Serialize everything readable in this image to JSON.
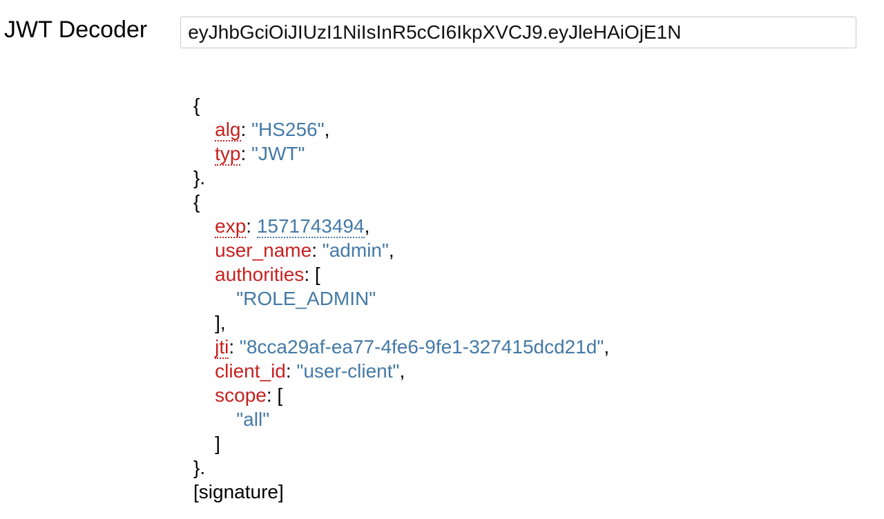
{
  "page": {
    "title": "JWT Decoder",
    "token_value": "eyJhbGciOiJIUzI1NiIsInR5cCI6IkpXVCJ9.eyJleHAiOjE1N"
  },
  "decoded": {
    "open_brace": "{",
    "close_brace": "}",
    "dot": ".",
    "open_bracket": "[",
    "close_bracket": "]",
    "colon_space": ": ",
    "comma": ",",
    "signature_label": "[signature]",
    "header": {
      "alg": {
        "key": "alg",
        "value": "\"HS256\""
      },
      "typ": {
        "key": "typ",
        "value": "\"JWT\""
      }
    },
    "payload": {
      "exp": {
        "key": "exp",
        "value": "1571743494"
      },
      "user_name": {
        "key": "user_name",
        "value": "\"admin\""
      },
      "authorities": {
        "key": "authorities",
        "values": [
          "\"ROLE_ADMIN\""
        ]
      },
      "jti": {
        "key": "jti",
        "value": "\"8cca29af-ea77-4fe6-9fe1-327415dcd21d\""
      },
      "client_id": {
        "key": "client_id",
        "value": "\"user-client\""
      },
      "scope": {
        "key": "scope",
        "values": [
          "\"all\""
        ]
      }
    }
  }
}
